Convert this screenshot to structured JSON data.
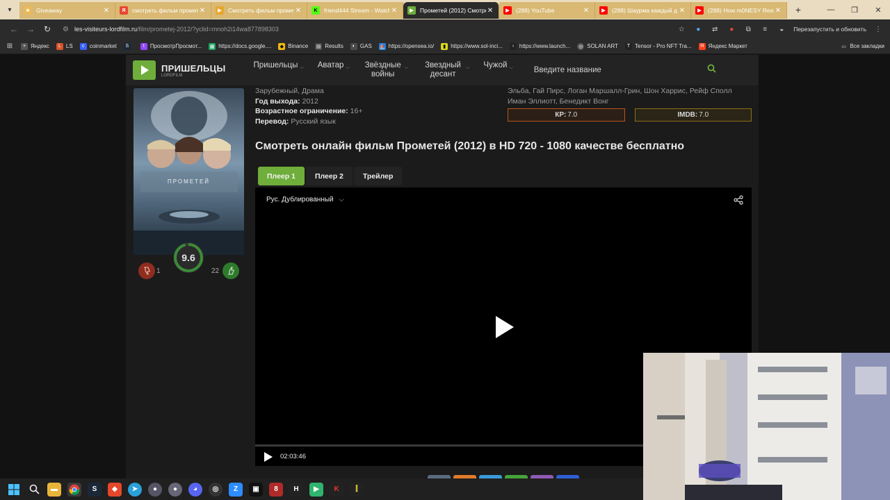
{
  "browser": {
    "tabs": [
      {
        "title": "Giveaway",
        "favicon": "gift-icon",
        "color": "#e8b95a"
      },
      {
        "title": "смотреть фильм промет",
        "favicon": "yandex-icon",
        "color": "#e8472f"
      },
      {
        "title": "Смотреть фильм промет",
        "favicon": "film-icon",
        "color": "#e8a72f"
      },
      {
        "title": "friend444 Stream - Watch",
        "favicon": "kick-icon",
        "color": "#53fc18"
      },
      {
        "title": "Прометей (2012) Смотре",
        "favicon": "lordfilm-icon",
        "color": "#6fae3a",
        "active": true
      },
      {
        "title": "(288) YouTube",
        "favicon": "youtube-icon",
        "color": "#ff0000"
      },
      {
        "title": "(288) Шаурма каждый д",
        "favicon": "youtube-icon",
        "color": "#ff0000"
      },
      {
        "title": "(288) How m0NESY Reall",
        "favicon": "youtube-icon",
        "color": "#ff0000"
      }
    ],
    "url": {
      "domain": "les-visiteurs-lordfilm.ru",
      "path": "/film/prometej-2012/?yclid=mnoh2i14wa877898303"
    },
    "relaunch_label": "Перезапустить и обновить",
    "bookmarks": [
      {
        "label": "Яндекс",
        "icon": "plus-icon",
        "color": "#555"
      },
      {
        "label": "LS",
        "icon": "ls-icon",
        "color": "#d9532b"
      },
      {
        "label": "coinmarket",
        "icon": "coinmarket-icon",
        "color": "#3861fb"
      },
      {
        "label": "",
        "icon": "steam-icon",
        "color": "#1b2838"
      },
      {
        "label": "ПросмотрПросмот...",
        "icon": "twitch-icon",
        "color": "#9146ff"
      },
      {
        "label": "https://docs.google....",
        "icon": "sheets-icon",
        "color": "#1fa463"
      },
      {
        "label": "Binance",
        "icon": "binance-icon",
        "color": "#f0b90b"
      },
      {
        "label": "Results",
        "icon": "results-icon",
        "color": "#4a4a4a"
      },
      {
        "label": "GAS",
        "icon": "gas-icon",
        "color": "#4a4a4a"
      },
      {
        "label": "https://opensea.io/",
        "icon": "opensea-icon",
        "color": "#2081e2"
      },
      {
        "label": "https://www.sol-inci...",
        "icon": "sol-icon",
        "color": "#d8d820"
      },
      {
        "label": "https://www.launch...",
        "icon": "launch-icon",
        "color": "#222"
      },
      {
        "label": "SOLAN ART",
        "icon": "solanart-icon",
        "color": "#555"
      },
      {
        "label": "Tensor - Pro NFT Tra...",
        "icon": "tensor-icon",
        "color": "#222"
      },
      {
        "label": "Яндекс Маркет",
        "icon": "market-icon",
        "color": "#fc3f1d"
      }
    ],
    "all_bookmarks_label": "Все закладки"
  },
  "site": {
    "logo_title": "ПРИШЕЛЬЦЫ",
    "logo_sub": "LORDFILM",
    "nav": [
      {
        "label": "Пришельцы"
      },
      {
        "label": "Аватар"
      },
      {
        "label": "Звёздные войны"
      },
      {
        "label": "Звездный десант"
      },
      {
        "label": "Чужой"
      }
    ],
    "search_placeholder": "Введите название"
  },
  "movie": {
    "genres_tail": "Зарубежный, Драма",
    "year_label": "Год выхода:",
    "year": "2012",
    "age_label": "Возрастное ограничение:",
    "age": "16+",
    "translation_label": "Перевод:",
    "translation": "Русский язык",
    "cast_line1": "Эльба, Гай Пирс, Логан Маршалл-Грин, Шон Харрис, Рейф Сполл",
    "cast_line2": "Иман Эллиотт, Бенедикт Вонг",
    "kp_label": "КР:",
    "kp_value": "7.0",
    "imdb_label": "IMDB:",
    "imdb_value": "7.0",
    "poster_title": "ПРОМЕТЕЙ",
    "score": "9.6",
    "score_fraction": 0.96,
    "dislikes": "1",
    "likes": "22",
    "watch_title": "Смотреть онлайн фильм Прометей (2012) в HD 720 - 1080 качестве бесплатно"
  },
  "player": {
    "tabs": [
      {
        "label": "Плеер 1",
        "active": true
      },
      {
        "label": "Плеер 2"
      },
      {
        "label": "Трейлер"
      }
    ],
    "dub": "Рус. Дублированный",
    "duration": "02:03:46",
    "progress": 0.0
  },
  "taskbar": {
    "icons": [
      "windows-start-icon",
      "search-icon",
      "explorer-icon",
      "chrome-icon",
      "steam-icon",
      "brave-icon",
      "telegram-icon",
      "app-icon",
      "app-icon",
      "discord-icon",
      "obs-icon",
      "zoom-icon",
      "epic-icon",
      "app-icon",
      "app-icon",
      "lordfilm-icon",
      "app-icon",
      "app-icon"
    ]
  }
}
